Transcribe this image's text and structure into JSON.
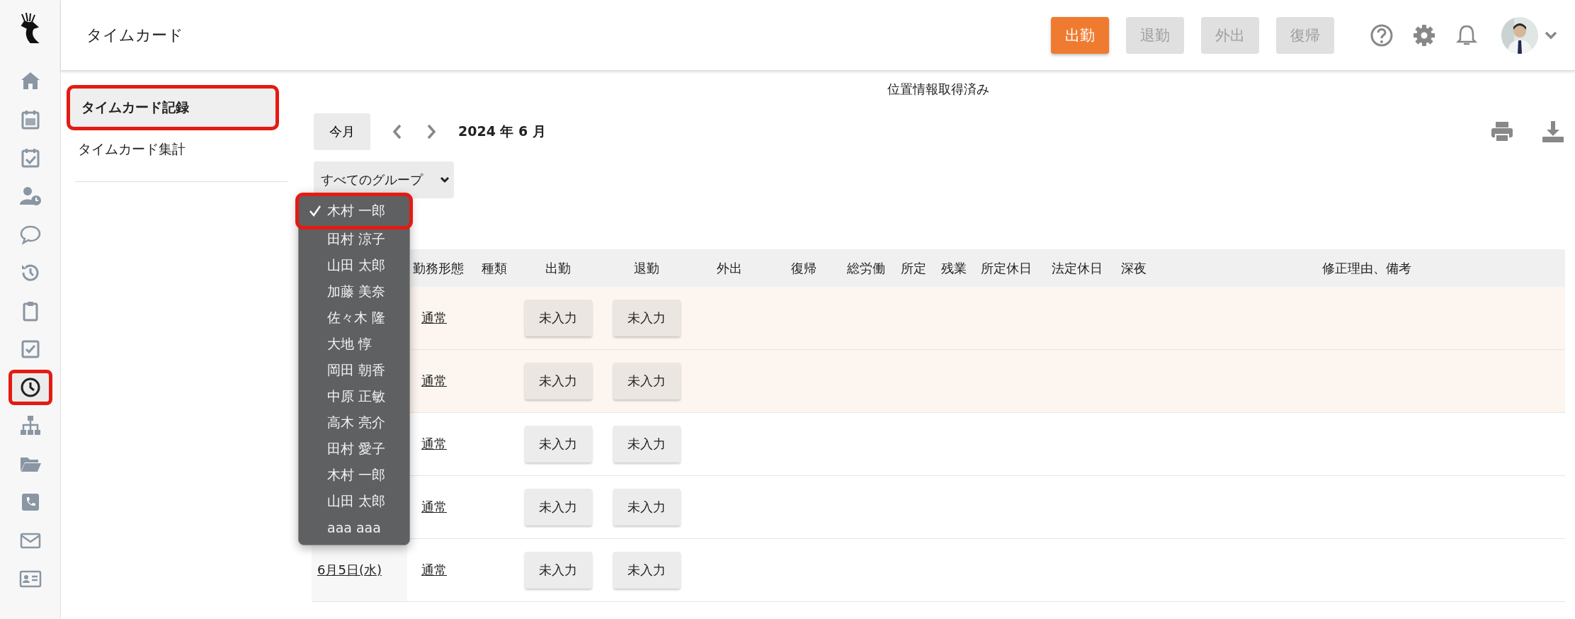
{
  "header": {
    "title": "タイムカード",
    "punch_buttons": [
      {
        "label": "出勤",
        "disabled": false
      },
      {
        "label": "退勤",
        "disabled": true
      },
      {
        "label": "外出",
        "disabled": true
      },
      {
        "label": "復帰",
        "disabled": true
      }
    ]
  },
  "sidebar": {
    "items": [
      {
        "kind": "home",
        "selected": false,
        "highlighted": false
      },
      {
        "kind": "calendar",
        "selected": false,
        "highlighted": false
      },
      {
        "kind": "calendar-check",
        "selected": false,
        "highlighted": false
      },
      {
        "kind": "user-clock",
        "selected": false,
        "highlighted": false
      },
      {
        "kind": "chat",
        "selected": false,
        "highlighted": false
      },
      {
        "kind": "history",
        "selected": false,
        "highlighted": false
      },
      {
        "kind": "clipboard",
        "selected": false,
        "highlighted": false
      },
      {
        "kind": "checkbox",
        "selected": false,
        "highlighted": false
      },
      {
        "kind": "clock",
        "selected": true,
        "highlighted": true
      },
      {
        "kind": "sitemap",
        "selected": false,
        "highlighted": false
      },
      {
        "kind": "folder",
        "selected": false,
        "highlighted": false
      },
      {
        "kind": "phone",
        "selected": false,
        "highlighted": false
      },
      {
        "kind": "mail",
        "selected": false,
        "highlighted": false
      },
      {
        "kind": "id-card",
        "selected": false,
        "highlighted": false
      }
    ]
  },
  "menu": {
    "items": [
      {
        "label": "タイムカード記録",
        "selected": true,
        "highlighted": true
      },
      {
        "label": "タイムカード集計",
        "selected": false,
        "highlighted": false
      }
    ]
  },
  "location_status": "位置情報取得済み",
  "toolbar": {
    "today_button": "今月",
    "month": "2024 年 6 月"
  },
  "group_select": {
    "value": "すべてのグループ"
  },
  "user_dropdown": {
    "items": [
      {
        "label": "木村 一郎",
        "selected": true,
        "highlighted": true
      },
      {
        "label": "田村 涼子",
        "selected": false,
        "highlighted": false
      },
      {
        "label": "山田 太郎",
        "selected": false,
        "highlighted": false
      },
      {
        "label": "加藤 美奈",
        "selected": false,
        "highlighted": false
      },
      {
        "label": "佐々木 隆",
        "selected": false,
        "highlighted": false
      },
      {
        "label": "大地 惇",
        "selected": false,
        "highlighted": false
      },
      {
        "label": "岡田 朝香",
        "selected": false,
        "highlighted": false
      },
      {
        "label": "中原 正敏",
        "selected": false,
        "highlighted": false
      },
      {
        "label": "高木 亮介",
        "selected": false,
        "highlighted": false
      },
      {
        "label": "田村 愛子",
        "selected": false,
        "highlighted": false
      },
      {
        "label": "木村 一郎",
        "selected": false,
        "highlighted": false
      },
      {
        "label": "山田 太郎",
        "selected": false,
        "highlighted": false
      },
      {
        "label": "aaa aaa",
        "selected": false,
        "highlighted": false
      }
    ]
  },
  "table": {
    "columns": [
      "勤務形態",
      "種類",
      "出勤",
      "退勤",
      "外出",
      "復帰",
      "総労働",
      "所定",
      "残業",
      "所定休日",
      "法定休日",
      "深夜",
      "修正理由、備考"
    ],
    "rows": [
      {
        "work_type": "通常",
        "clock_in": "未入力",
        "clock_out": "未入力",
        "holiday": true
      },
      {
        "work_type": "通常",
        "clock_in": "未入力",
        "clock_out": "未入力",
        "holiday": true
      },
      {
        "work_type": "通常",
        "clock_in": "未入力",
        "clock_out": "未入力",
        "holiday": false
      },
      {
        "work_type": "通常",
        "clock_in": "未入力",
        "clock_out": "未入力",
        "holiday": false
      },
      {
        "date": "6月5日(水)",
        "work_type": "通常",
        "clock_in": "未入力",
        "clock_out": "未入力",
        "holiday": false
      }
    ]
  }
}
